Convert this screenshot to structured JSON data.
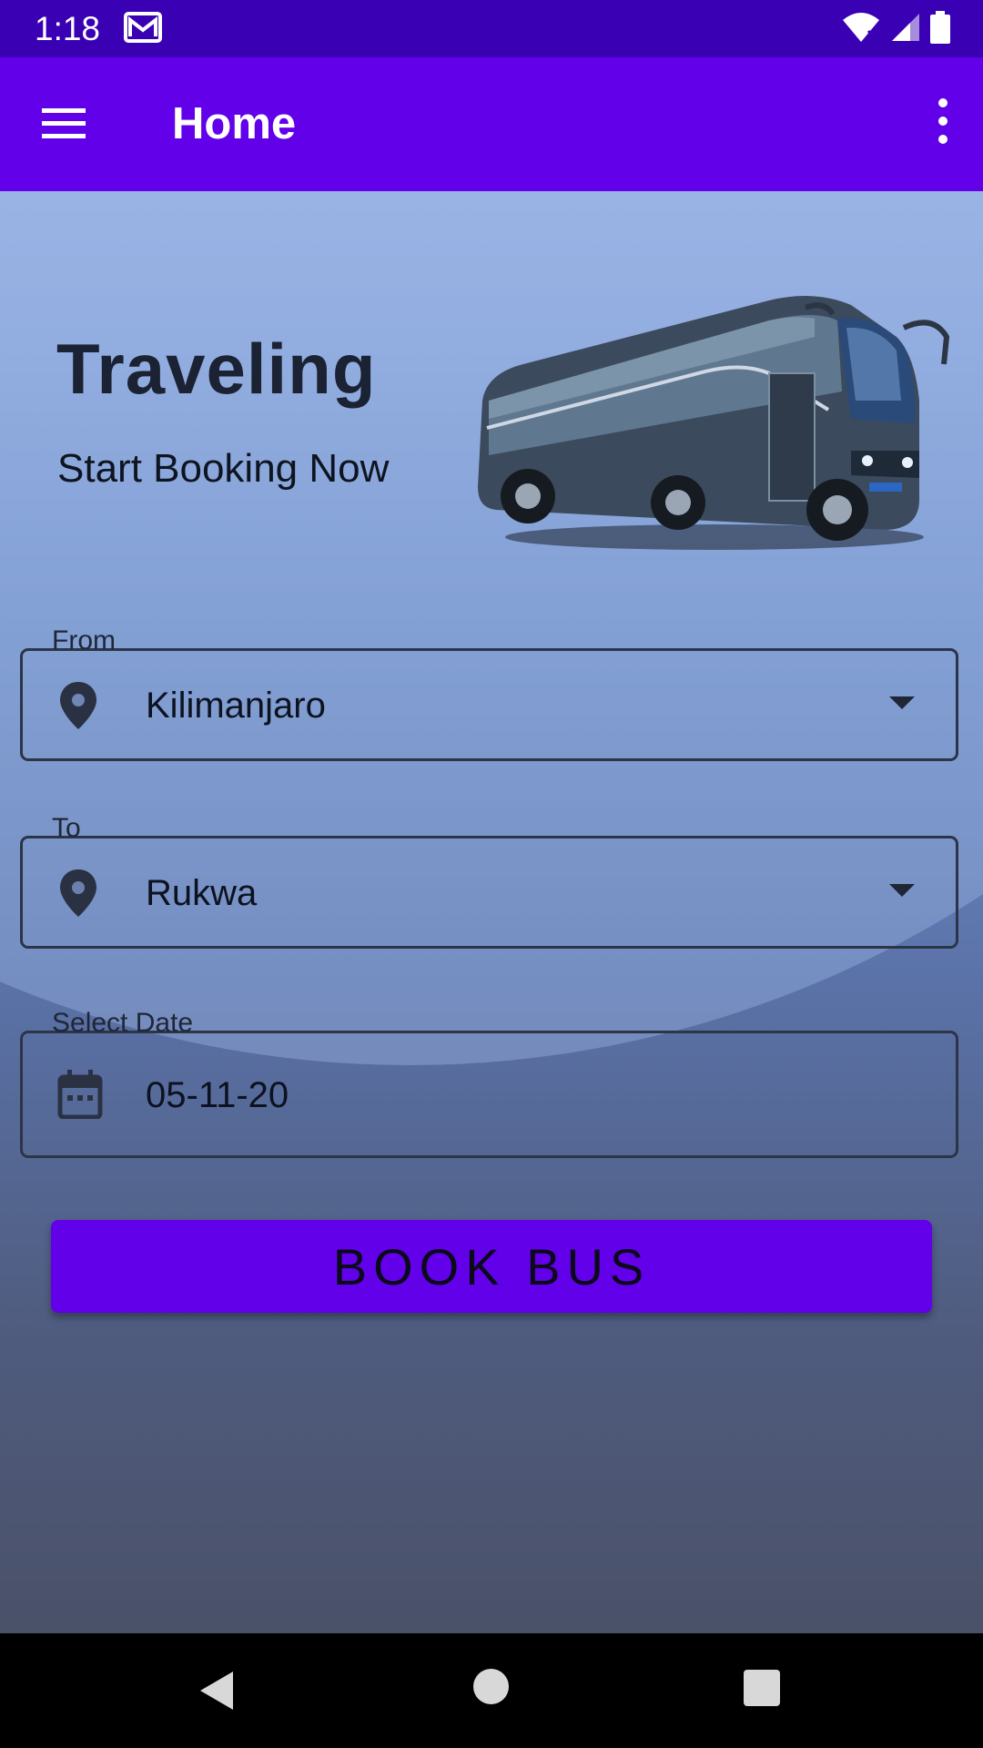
{
  "status_bar": {
    "time": "1:18",
    "icons": [
      "gmail-icon",
      "wifi-icon",
      "signal-icon",
      "battery-icon"
    ]
  },
  "app_bar": {
    "title": "Home",
    "menu_icon": "hamburger-menu-icon",
    "overflow_icon": "more-vert-icon"
  },
  "hero": {
    "title": "Traveling",
    "subtitle": "Start Booking Now"
  },
  "form": {
    "from": {
      "label": "From",
      "value": "Kilimanjaro",
      "icon": "location-pin-icon"
    },
    "to": {
      "label": "To",
      "value": "Rukwa",
      "icon": "location-pin-icon"
    },
    "date": {
      "label": "Select Date",
      "value": "05-11-20",
      "icon": "calendar-icon"
    },
    "submit_label": "BOOK BUS"
  },
  "colors": {
    "primary": "#6200ea",
    "status_bar": "#3a00b3",
    "background_top": "#93ace0",
    "background_bottom": "#4a5169"
  }
}
